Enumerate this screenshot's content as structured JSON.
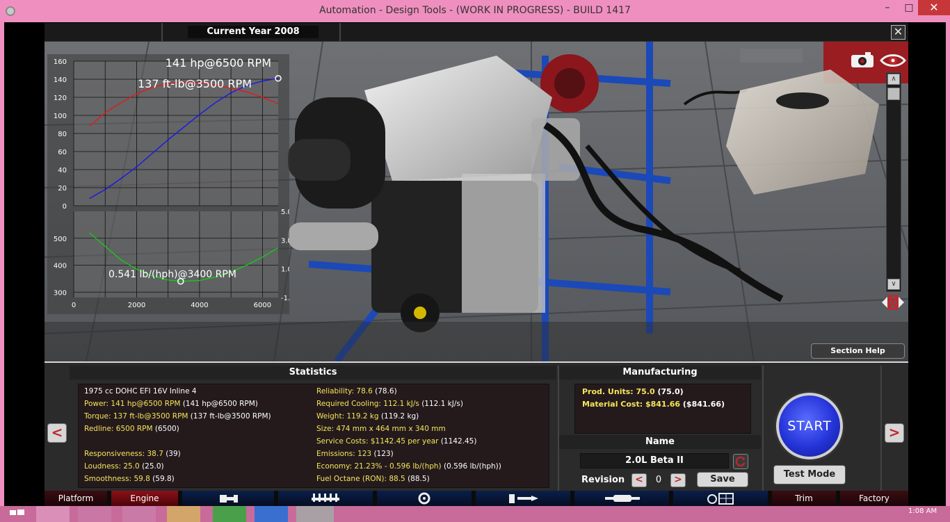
{
  "window": {
    "title": "Automation - Design Tools - (WORK IN PROGRESS) - BUILD 1417",
    "min": "–",
    "max": "□",
    "close": "✕"
  },
  "topbar": {
    "year": "Current Year 2008"
  },
  "scene": {
    "close": "✕",
    "section_help": "Section Help",
    "scroll_up": "∧",
    "scroll_down": "∨"
  },
  "chart_data": [
    {
      "type": "line",
      "title": "",
      "annotations": [
        "141 hp@6500 RPM",
        "137 ft-lb@3500 RPM"
      ],
      "xlim": [
        0,
        6500
      ],
      "ylim": [
        0,
        160
      ],
      "yticks": [
        0,
        20,
        40,
        60,
        80,
        100,
        120,
        140,
        160
      ],
      "series": [
        {
          "color": "#1818e6",
          "x": [
            500,
            1000,
            1500,
            2000,
            2500,
            3000,
            3500,
            4000,
            4500,
            5000,
            5500,
            6000,
            6500
          ],
          "values": [
            8,
            18,
            30,
            43,
            58,
            73,
            87,
            101,
            114,
            125,
            133,
            138,
            141
          ]
        },
        {
          "color": "#e61818",
          "x": [
            500,
            1000,
            1500,
            2000,
            2500,
            3000,
            3500,
            4000,
            4500,
            5000,
            5500,
            6000,
            6500
          ],
          "values": [
            88,
            103,
            114,
            124,
            131,
            135,
            137,
            136,
            134,
            130,
            126,
            120,
            113
          ]
        }
      ]
    },
    {
      "type": "line",
      "annotations": [
        "0.541 lb/(hph)@3400 RPM"
      ],
      "xticks": [
        0,
        2000,
        4000,
        6000
      ],
      "xlim": [
        0,
        6500
      ],
      "ylim": [
        280,
        600
      ],
      "yticks": [
        300,
        400,
        500
      ],
      "y2ticks": [
        -1.0,
        1.0,
        3.0,
        5.0
      ],
      "y2lim": [
        -1.0,
        5.0
      ],
      "series": [
        {
          "color": "#18c818",
          "x": [
            500,
            1000,
            1500,
            2000,
            2500,
            3000,
            3400,
            4000,
            4500,
            5000,
            5500,
            6000,
            6500
          ],
          "values": [
            520,
            470,
            420,
            385,
            360,
            345,
            340,
            343,
            356,
            375,
            400,
            430,
            465
          ]
        }
      ]
    }
  ],
  "statistics": {
    "header": "Statistics",
    "left": [
      {
        "label": "1975 cc DOHC EFI 16V Inline 4",
        "v2": ""
      },
      {
        "label": "Power: 141 hp@6500 RPM",
        "v2": " (141 hp@6500 RPM)"
      },
      {
        "label": "Torque: 137 ft-lb@3500 RPM",
        "v2": " (137 ft-lb@3500 RPM)"
      },
      {
        "label": "Redline: 6500 RPM",
        "v2": " (6500)"
      },
      {
        "label": "Responsiveness: 38.7",
        "v2": " (39)"
      },
      {
        "label": "Loudness: 25.0",
        "v2": " (25.0)"
      },
      {
        "label": "Smoothness: 59.8",
        "v2": " (59.8)"
      }
    ],
    "right": [
      {
        "label": "Reliability: 78.6",
        "v2": " (78.6)"
      },
      {
        "label": "Required Cooling: 112.1 kJ/s",
        "v2": " (112.1 kJ/s)"
      },
      {
        "label": "Weight: 119.2 kg",
        "v2": " (119.2 kg)"
      },
      {
        "label": "Size: 474 mm x 464 mm x 340 mm",
        "v2": ""
      },
      {
        "label": "Service Costs: $1142.45 per year",
        "v2": " (1142.45)"
      },
      {
        "label": "Emissions: 123",
        "v2": " (123)"
      },
      {
        "label": "Economy: 21.23% - 0.596 lb/(hph)",
        "v2": " (0.596 lb/(hph))"
      },
      {
        "label": "Fuel Octane (RON): 88.5",
        "v2": " (88.5)"
      }
    ]
  },
  "manufacturing": {
    "header": "Manufacturing",
    "prod_units": "Prod. Units: 75.0",
    "prod_units_v2": " (75.0)",
    "material_cost": "Material Cost: $841.66",
    "material_cost_v2": " ($841.66)"
  },
  "name": {
    "header": "Name",
    "value": "2.0L Beta II",
    "revision_label": "Revision",
    "revision": "0",
    "prev": "<",
    "next": ">",
    "save": "Save"
  },
  "controls": {
    "start": "START",
    "test_mode": "Test Mode",
    "prev": "<",
    "next": ">"
  },
  "tabs": [
    {
      "label": "Platform"
    },
    {
      "label": "Engine"
    },
    {
      "label": "Trim"
    },
    {
      "label": "Factory"
    }
  ],
  "taskbar": {
    "clock": "1:08 AM"
  },
  "colors": {
    "titlebar": "#ef8fbf",
    "accent_red": "#c0282e",
    "stat_yellow": "#f5e55a",
    "start_blue": "#2434d8"
  }
}
